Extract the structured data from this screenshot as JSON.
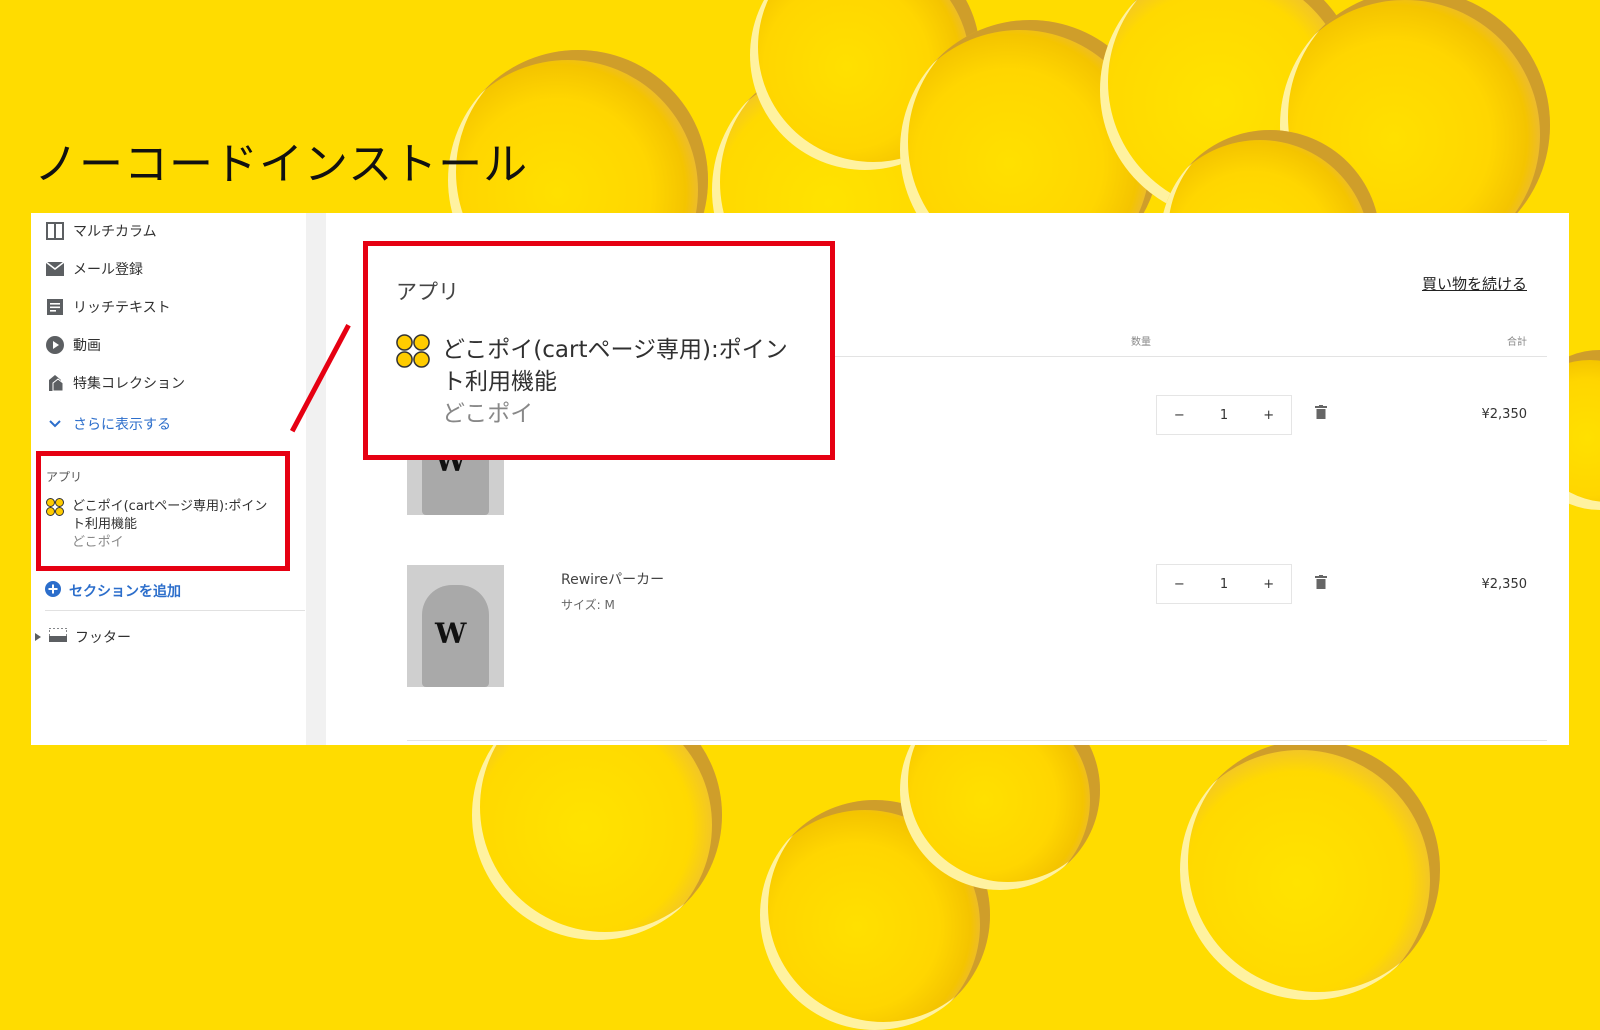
{
  "slide": {
    "title": "ノーコードインストール"
  },
  "sidebar": {
    "items": [
      {
        "label": "マルチカラム",
        "icon": "columns-icon"
      },
      {
        "label": "メール登録",
        "icon": "mail-icon"
      },
      {
        "label": "リッチテキスト",
        "icon": "text-block-icon"
      },
      {
        "label": "動画",
        "icon": "play-icon"
      },
      {
        "label": "特集コレクション",
        "icon": "collection-icon"
      }
    ],
    "show_more": "さらに表示する",
    "apps_label": "アプリ",
    "app": {
      "name": "どこポイ(cartページ専用):ポイント利用機能",
      "vendor": "どこポイ"
    },
    "add_section": "セクションを追加",
    "footer": "フッター"
  },
  "zoom": {
    "title": "アプリ",
    "app_name_line1": "どこポイ(cartページ専用):ポイン",
    "app_name_line2": "ト利用機能",
    "vendor": "どこポイ"
  },
  "cart": {
    "continue_shopping": "買い物を続ける",
    "col_quantity": "数量",
    "col_total": "合計",
    "items": [
      {
        "name": "",
        "size_label": "",
        "quantity": "1",
        "price": "¥2,350"
      },
      {
        "name": "Rewireパーカー",
        "size_label": "サイズ: M",
        "quantity": "1",
        "price": "¥2,350"
      }
    ],
    "minus": "−",
    "plus": "+"
  },
  "colors": {
    "background": "#ffdc00",
    "highlight": "#e60012",
    "link": "#2c6ecb"
  }
}
